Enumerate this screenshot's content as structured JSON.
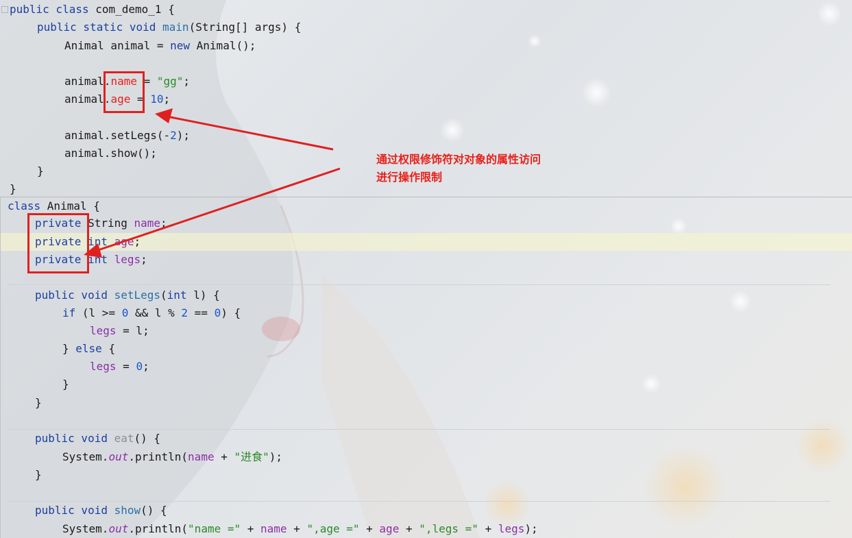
{
  "annotation": {
    "lines": [
      "通过权限修饰符对对象的属性访问",
      "进行操作限制"
    ]
  },
  "top_code": {
    "l1": {
      "a": "public class ",
      "b": "com_demo_1 {"
    },
    "l2": {
      "a": "public static void ",
      "b": "main",
      "c": "(String[] args) {"
    },
    "l3": {
      "a": "Animal animal = ",
      "b": "new ",
      "c": "Animal();"
    },
    "l4": {
      "a": "animal.",
      "b": "name",
      "c": " = ",
      "d": "\"gg\"",
      "e": ";"
    },
    "l5": {
      "a": "animal.",
      "b": "age",
      "c": " = ",
      "d": "10",
      "e": ";"
    },
    "l6": {
      "a": "animal.setLegs(-",
      "b": "2",
      "c": ");"
    },
    "l7": {
      "a": "animal.show();"
    },
    "l8": {
      "a": "}"
    },
    "l9": {
      "a": "}"
    }
  },
  "bottom_code": {
    "l1": {
      "a": "class ",
      "b": "Animal {"
    },
    "l2": {
      "a": "private ",
      "b": "String ",
      "c": "name",
      "d": ";"
    },
    "l3": {
      "a": "private ",
      "b": "int ",
      "c": "age",
      "d": ";"
    },
    "l4": {
      "a": "private ",
      "b": "int ",
      "c": "legs",
      "d": ";"
    },
    "l5": {
      "a": "public void ",
      "b": "setLegs",
      "c": "(",
      "d": "int ",
      "e": "l) {"
    },
    "l6": {
      "a": "if ",
      "b": "(l >= ",
      "c": "0",
      "d": " && l % ",
      "e": "2",
      "f": " == ",
      "g": "0",
      "h": ") {"
    },
    "l7": {
      "a": "legs",
      "b": " = l;"
    },
    "l8": {
      "a": "} ",
      "b": "else ",
      "c": "{"
    },
    "l9": {
      "a": "legs",
      "b": " = ",
      "c": "0",
      "d": ";"
    },
    "l10": {
      "a": "}"
    },
    "l11": {
      "a": "}"
    },
    "l12": {
      "a": "public void ",
      "b": "eat",
      "c": "() {"
    },
    "l13": {
      "a": "System.",
      "b": "out",
      "c": ".println(",
      "d": "name",
      "e": " + ",
      "f": "\"进食\"",
      "g": ");"
    },
    "l14": {
      "a": "}"
    },
    "l15": {
      "a": "public void ",
      "b": "show",
      "c": "() {"
    },
    "l16": {
      "a": "System.",
      "b": "out",
      "c": ".println(",
      "d": "\"name =\"",
      "e": " + ",
      "f": "name",
      "g": " + ",
      "h": "\",age =\"",
      "i": " + ",
      "j": "age",
      "k": " + ",
      "l": "\",legs =\"",
      "m": " + ",
      "n": "legs",
      "o": ");"
    }
  },
  "colors": {
    "accent_red": "#e8201a",
    "keyword": "#1b3fa0",
    "string": "#2a8a2a",
    "number": "#1a55c8",
    "field": "#8b2fa6"
  }
}
